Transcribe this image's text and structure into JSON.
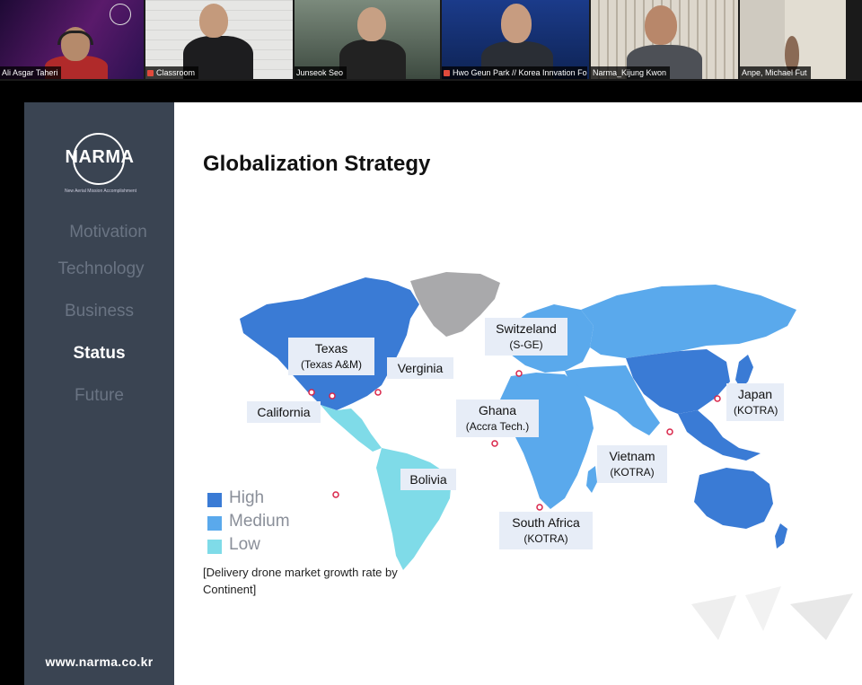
{
  "participants": [
    {
      "name": "Ali Asgar Taheri"
    },
    {
      "name": "Classroom"
    },
    {
      "name": "Junseok Seo"
    },
    {
      "name": "Hwo Geun Park // Korea Innvation Fo..."
    },
    {
      "name": "Narma_Kijung Kwon"
    },
    {
      "name": "Anpe, Michael Fut"
    }
  ],
  "slide": {
    "logo": {
      "text": "NARMA",
      "tagline": "New Aerial Mission Accomplishment"
    },
    "nav": [
      "Motivation",
      "Technology",
      "Business",
      "Status",
      "Future"
    ],
    "active_nav": "Status",
    "url": "www.narma.co.kr",
    "title": "Globalization Strategy",
    "locations": [
      {
        "name": "Texas",
        "sub": "(Texas A&M)"
      },
      {
        "name": "Verginia",
        "sub": ""
      },
      {
        "name": "California",
        "sub": ""
      },
      {
        "name": "Switzeland",
        "sub": "(S-GE)"
      },
      {
        "name": "Ghana",
        "sub": "(Accra Tech.)"
      },
      {
        "name": "Bolivia",
        "sub": ""
      },
      {
        "name": "South Africa",
        "sub": "(KOTRA)"
      },
      {
        "name": "Vietnam",
        "sub": "(KOTRA)"
      },
      {
        "name": "Japan",
        "sub": "(KOTRA)"
      }
    ],
    "legend": [
      {
        "label": "High",
        "color": "#3a7bd5"
      },
      {
        "label": "Medium",
        "color": "#5aa9ec"
      },
      {
        "label": "Low",
        "color": "#7fdbe8"
      }
    ],
    "caption": "[Delivery drone market growth rate by Continent]"
  },
  "colors": {
    "high": "#3a7bd5",
    "medium": "#5aa9ec",
    "low": "#7fdbe8",
    "greenland": "#a9a9ab",
    "sidebar": "#3a4452"
  }
}
